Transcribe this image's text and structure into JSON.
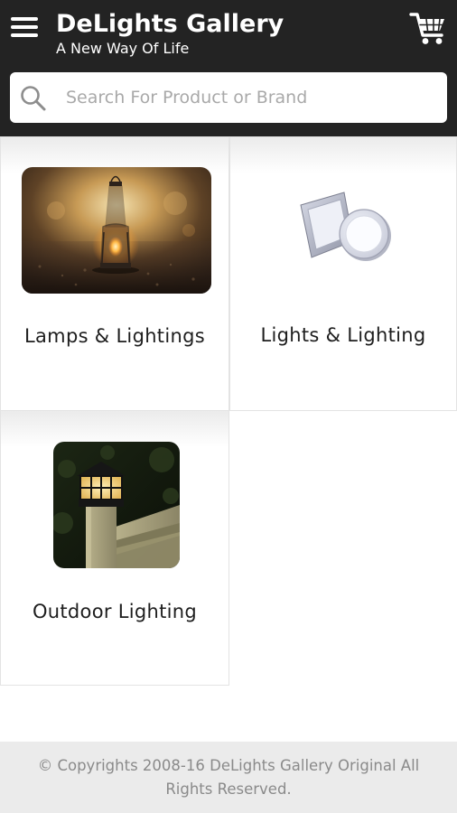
{
  "header": {
    "title": "DeLights Gallery",
    "tagline": "A New Way Of Life",
    "menu_icon": "hamburger-menu-icon",
    "cart_icon": "shopping-cart-icon",
    "background_color": "#232323"
  },
  "search": {
    "placeholder": "Search For Product or Brand",
    "value": "",
    "icon": "search-icon"
  },
  "categories": [
    {
      "label": "Lamps & Lightings",
      "image": "lantern-photo"
    },
    {
      "label": "Lights & Lighting",
      "image": "panel-lights-photo"
    },
    {
      "label": "Outdoor Lighting",
      "image": "outdoor-post-light-photo"
    }
  ],
  "footer": {
    "text": "© Copyrights 2008-16 DeLights Gallery Original All Rights Reserved."
  }
}
